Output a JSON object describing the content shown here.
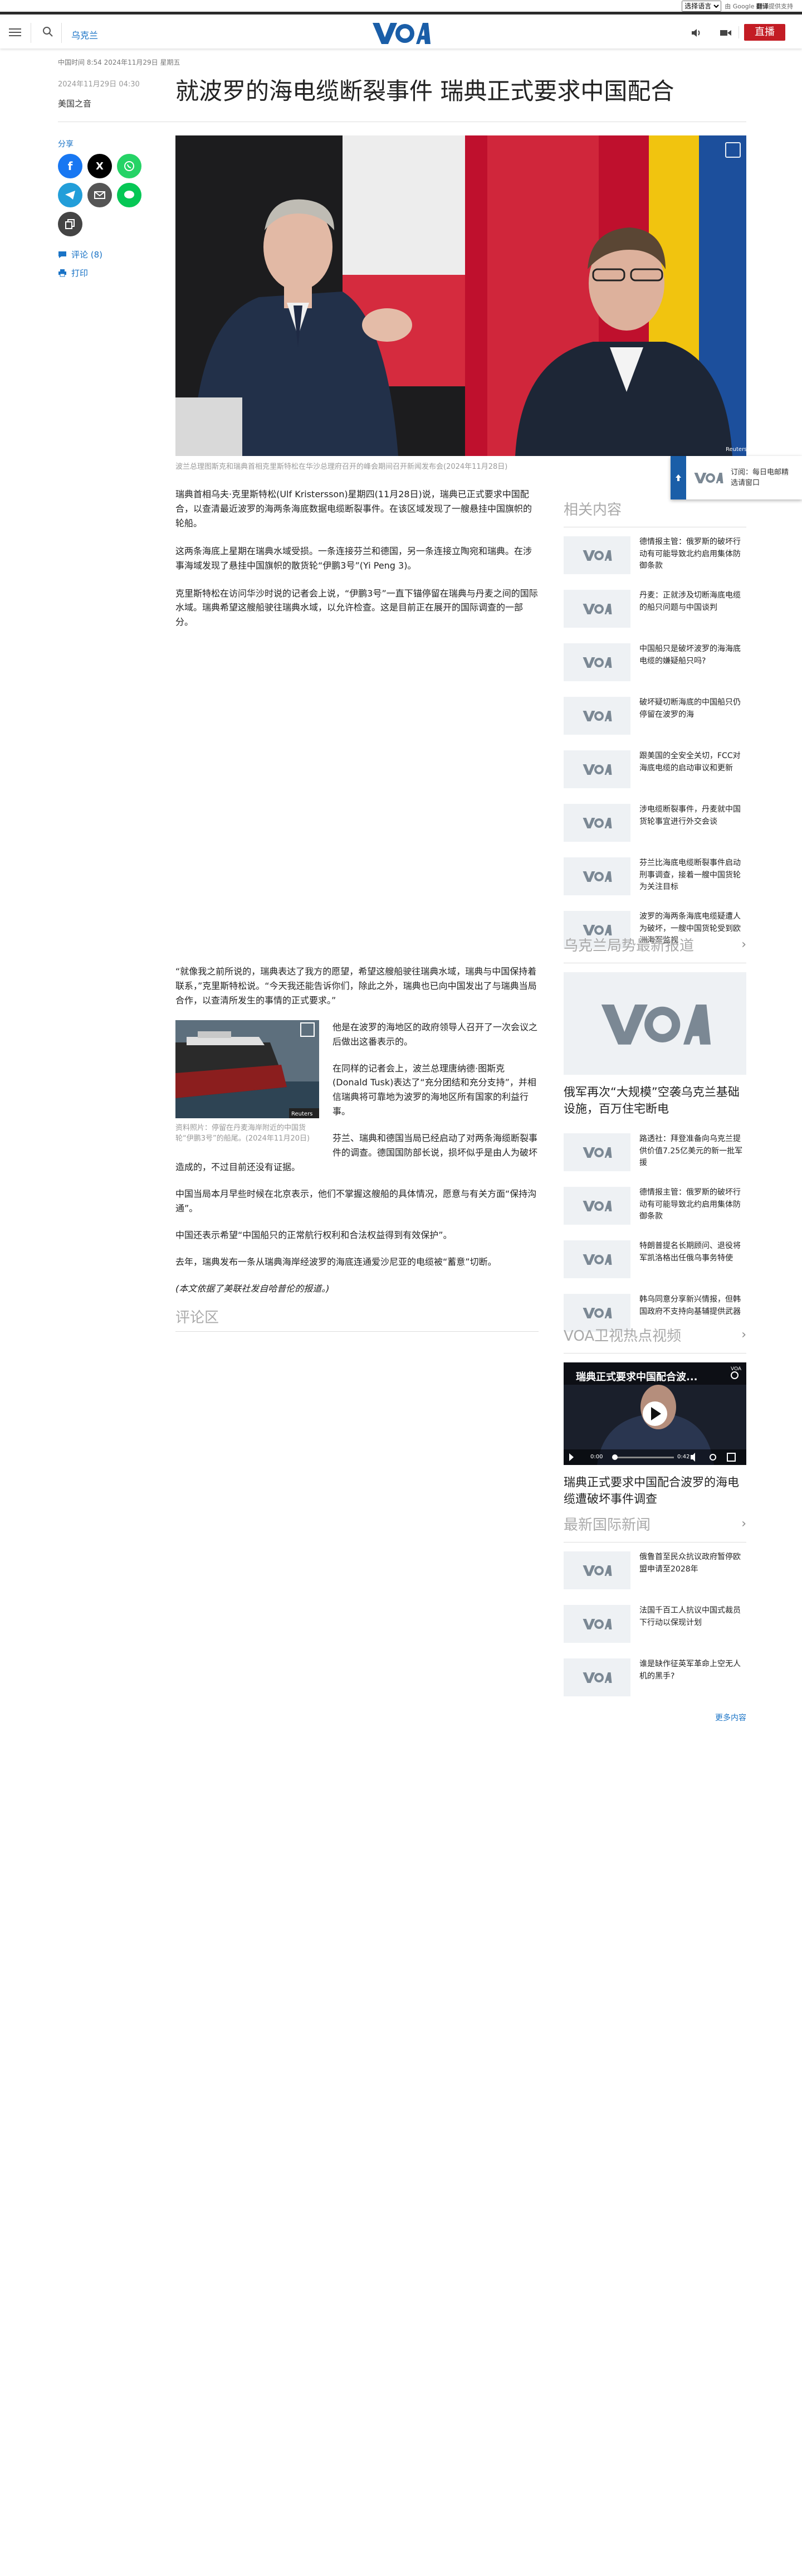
{
  "topbar": {
    "lang_select": "选择语言",
    "gt_powered": "由 Google",
    "gt_translate": "翻译",
    "gt_suffix": "提供支持"
  },
  "header": {
    "ukraine_link": "乌克兰",
    "live_label": "直播"
  },
  "article": {
    "dateline": "中国时间 8:54 2024年11月29日 星期五",
    "pubdate": "2024年11月29日 04:30",
    "byline": "美国之音",
    "title": "就波罗的海电缆断裂事件 瑞典正式要求中国配合",
    "share_label": "分享",
    "comments_link": "评论 (8)",
    "print_link": "打印",
    "hero_caption": "波兰总理图斯克和瑞典首相克里斯特松在华沙总理府召开的峰会期间召开新闻发布会(2024年11月28日)",
    "hero_credit": "Reuters",
    "paragraphs": [
      "瑞典首相乌夫·克里斯特松(Ulf Kristersson)星期四(11月28日)说，瑞典已正式要求中国配合，以查清最近波罗的海两条海底数据电缆断裂事件。在该区域发现了一艘悬挂中国旗帜的轮船。",
      "这两条海底上星期在瑞典水域受损。一条连接芬兰和德国，另一条连接立陶宛和瑞典。在涉事海域发现了悬挂中国旗帜的散货轮“伊鹏3号”(Yi Peng 3)。",
      "克里斯特松在访问华沙时说的记者会上说，“伊鹏3号”一直下锚停留在瑞典与丹麦之间的国际水域。瑞典希望这艘船驶往瑞典水域，以允许检查。这是目前正在展开的国际调查的一部分。"
    ],
    "paragraphs2": [
      "“就像我之前所说的，瑞典表达了我方的愿望，希望这艘船驶往瑞典水域，瑞典与中国保持着联系，”克里斯特松说。“今天我还能告诉你们，除此之外，瑞典也已向中国发出了与瑞典当局合作，以查清所发生的事情的正式要求。”"
    ],
    "inline_caption": "资料照片：停留在丹麦海岸附近的中国货轮“伊鹏3号”的船尾。(2024年11月20日)",
    "inline_credit": "Reuters",
    "wrap_paragraphs": [
      "他是在波罗的海地区的政府领导人召开了一次会议之后做出这番表示的。",
      "在同样的记者会上，波兰总理唐纳德·图斯克(Donald Tusk)表达了“充分团结和充分支持”，并相信瑞典将可靠地为波罗的海地区所有国家的利益行事。",
      "芬兰、瑞典和德国当局已经启动了对两条海缆断裂事件的调查。德国国防部长说，损坏似乎是由人为破坏造成的，不过目前还没有证据。",
      "中国当局本月早些时候在北京表示，他们不掌握这艘船的具体情况，愿意与有关方面“保持沟通”。",
      "中国还表示希望“中国船只的正常航行权利和合法权益得到有效保护”。",
      "去年，瑞典发布一条从瑞典海岸经波罗的海底连通爱沙尼亚的电缆被“蓄意”切断。"
    ],
    "source_note": "(本文依据了美联社发自哈普伦的报道。)",
    "comments_heading": "评论区"
  },
  "sidebar": {
    "related_heading": "相关内容",
    "related": [
      "德情报主管：俄罗斯的破坏行动有可能导致北约启用集体防御条款",
      "丹麦：正就涉及切断海底电缆的船只问题与中国谈判",
      "中国船只是破坏波罗的海海底电缆的嫌疑船只吗?",
      "破坏疑切断海底的中国船只仍停留在波罗的海",
      "跟美国的全安全关切，FCC对海底电缆的启动审议和更新",
      "涉电缆断裂事件，丹麦就中国货轮事宜进行外交会谈",
      "芬兰比海底电缆断裂事件启动刑事调查，接着一艘中国货轮为关注目标",
      "波罗的海两条海底电缆疑遭人为破坏，一艘中国货轮受到欧洲海军监视"
    ],
    "ukraine_heading": "乌克兰局势最新报道",
    "ukraine_lead": "俄军再次“大规模”空袭乌克兰基础设施，百万住宅断电",
    "ukraine": [
      "路透社：拜登准备向乌克兰提供价值7.25亿美元的新一批军援",
      "德情报主管：俄罗斯的破坏行动有可能导致北约启用集体防御条款",
      "特朗普提名长期顾问、退役将军凯洛格出任俄乌事务特使",
      "韩乌同意分享新兴情报，但韩国政府不支持向基辅提供武器"
    ],
    "video_heading": "VOA卫视热点视频",
    "video_title_overlay": "瑞典正式要求中国配合波...",
    "video_time_current": "0:00",
    "video_time_total": "0:42",
    "video_caption": "瑞典正式要求中国配合波罗的海电缆遭破坏事件调查",
    "intl_heading": "最新国际新闻",
    "intl": [
      "俄鲁首至民众抗议政府暂停欧盟申请至2028年",
      "法国千百工人抗议中国式裁员下行动以保现计划",
      "谁是缺作征英军革命上空无人机的黑手?"
    ],
    "more_link": "更多内容"
  },
  "popup": {
    "text": "订阅：每日电邮精选请窗口"
  }
}
